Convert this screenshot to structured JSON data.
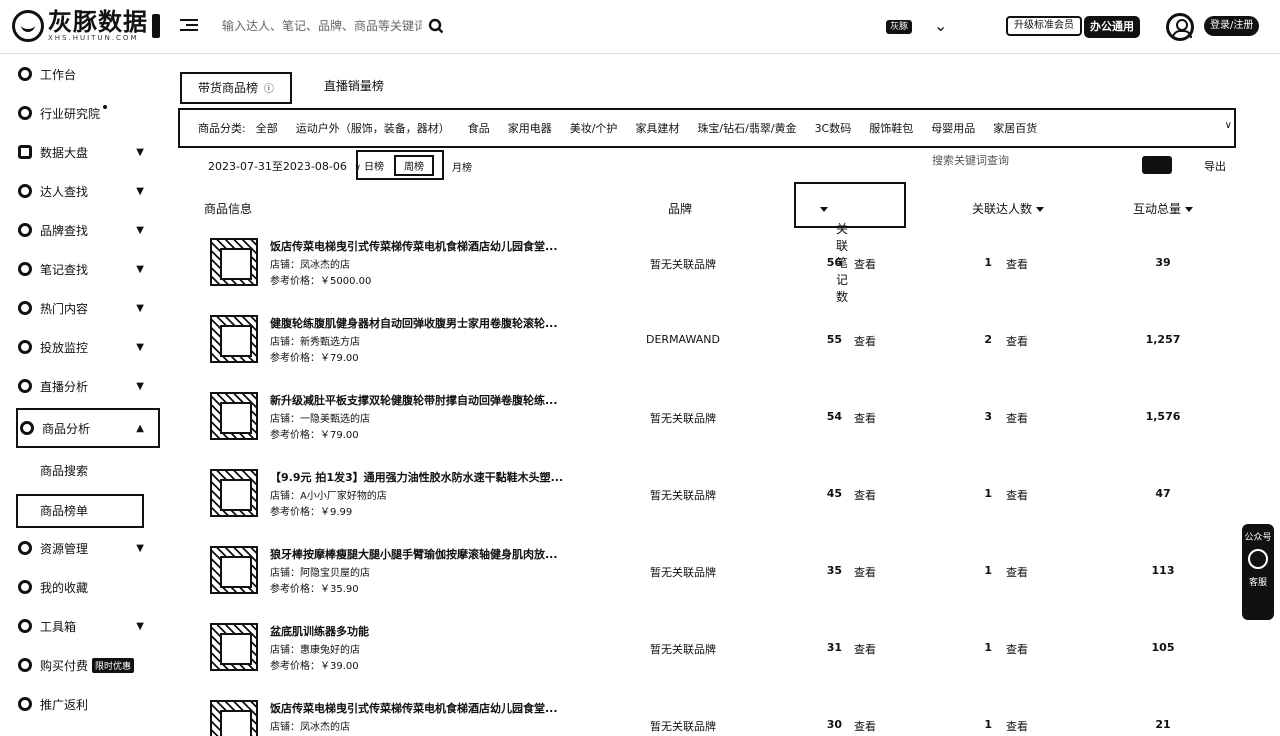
{
  "header": {
    "logo_title": "灰豚数据",
    "logo_subtitle": "XHS.HUITUN.COM",
    "search_placeholder": "输入达人、笔记、品牌、商品等关键词...",
    "account_badge": "灰豚",
    "upgrade_button": "升级标准会员",
    "office_button": "办公通用",
    "login_button": "登录/注册"
  },
  "sidebar": {
    "items": [
      {
        "label": "工作台"
      },
      {
        "label": "行业研究院"
      },
      {
        "label": "数据大盘"
      },
      {
        "label": "达人查找"
      },
      {
        "label": "品牌查找"
      },
      {
        "label": "笔记查找"
      },
      {
        "label": "热门内容"
      },
      {
        "label": "投放监控"
      },
      {
        "label": "直播分析"
      },
      {
        "label": "商品分析"
      }
    ],
    "sub_items": [
      "商品搜索",
      "商品榜单"
    ],
    "items_after": [
      {
        "label": "资源管理"
      },
      {
        "label": "我的收藏"
      },
      {
        "label": "工具箱"
      },
      {
        "label": "购买付费",
        "badge": "限时优惠"
      },
      {
        "label": "推广返利"
      }
    ]
  },
  "tabs": [
    "带货商品榜",
    "直播销量榜"
  ],
  "tab_info": "ⓘ",
  "categories": {
    "label": "商品分类:",
    "items": [
      "全部",
      "运动户外（服饰，装备，器材）",
      "食品",
      "家用电器",
      "美妆/个护",
      "家具建材",
      "珠宝/钻石/翡翠/黄金",
      "3C数码",
      "服饰鞋包",
      "母婴用品",
      "家居百货"
    ],
    "more": "∨"
  },
  "filters": {
    "date_range": "2023-07-31至2023-08-06",
    "period_day": "日榜",
    "period_week": "周榜",
    "period_month": "月榜",
    "search_placeholder": "搜索关键词查询",
    "export": "导出"
  },
  "table": {
    "headers": {
      "product": "商品信息",
      "brand": "品牌",
      "notes": "关联笔记数",
      "kols": "关联达人数",
      "interactions": "互动总量"
    },
    "view_label": "查看",
    "shop_prefix": "店铺：",
    "price_prefix": "参考价格：",
    "rows": [
      {
        "title": "饭店传菜电梯曳引式传菜梯传菜电机食梯酒店幼儿园食堂...",
        "shop": "店铺：凤冰杰的店",
        "price": "参考价格：￥5000.00",
        "brand": "暂无关联品牌",
        "notes": "56",
        "kols": "1",
        "interactions": "39"
      },
      {
        "title": "健腹轮练腹肌健身器材自动回弹收腹男士家用卷腹轮滚轮...",
        "shop": "店铺：新秀甄选方店",
        "price": "参考价格：￥79.00",
        "brand": "DERMAWAND",
        "notes": "55",
        "kols": "2",
        "interactions": "1,257"
      },
      {
        "title": "新升级减肚平板支撑双轮健腹轮带肘撑自动回弹卷腹轮练...",
        "shop": "店铺：一隐美甄选的店",
        "price": "参考价格：￥79.00",
        "brand": "暂无关联品牌",
        "notes": "54",
        "kols": "3",
        "interactions": "1,576"
      },
      {
        "title": "【9.9元 拍1发3】通用强力油性胶水防水速干黏鞋木头塑...",
        "shop": "店铺：A小小厂家好物的店",
        "price": "参考价格：￥9.99",
        "brand": "暂无关联品牌",
        "notes": "45",
        "kols": "1",
        "interactions": "47"
      },
      {
        "title": "狼牙棒按摩棒瘦腿大腿小腿手臂瑜伽按摩滚轴健身肌肉放...",
        "shop": "店铺：阿隐宝贝屋的店",
        "price": "参考价格：￥35.90",
        "brand": "暂无关联品牌",
        "notes": "35",
        "kols": "1",
        "interactions": "113"
      },
      {
        "title": "盆底肌训练器多功能",
        "shop": "店铺：惠康兔好的店",
        "price": "参考价格：￥39.00",
        "brand": "暂无关联品牌",
        "notes": "31",
        "kols": "1",
        "interactions": "105"
      },
      {
        "title": "饭店传菜电梯曳引式传菜梯传菜电机食梯酒店幼儿园食堂...",
        "shop": "店铺：凤冰杰的店",
        "price": "",
        "brand": "暂无关联品牌",
        "notes": "30",
        "kols": "1",
        "interactions": "21"
      }
    ]
  },
  "float_tool": {
    "label_top": "公众号",
    "label_bottom": "客服"
  }
}
